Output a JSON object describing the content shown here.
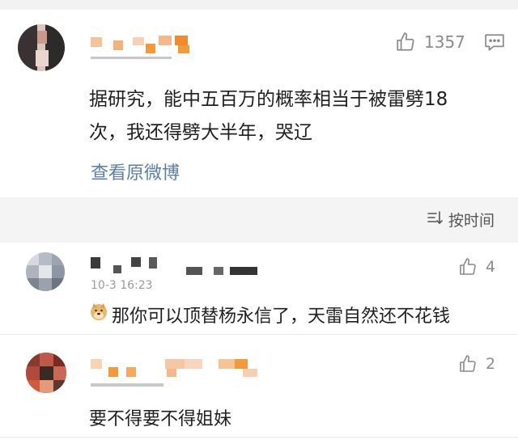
{
  "main_comment": {
    "like_count": "1357",
    "text_line1": "据研究，能中五百万的概率相当于被雷劈18",
    "text_line2": "次，我还得劈大半年，哭辽",
    "view_original_label": "查看原微博"
  },
  "sort": {
    "label": "按时间"
  },
  "replies": [
    {
      "like_count": "4",
      "timestamp": "10-3 16:23",
      "text": "那你可以顶替杨永信了，天雷自然还不花钱"
    },
    {
      "like_count": "2",
      "text": "要不得要不得姐妹"
    }
  ],
  "colors": {
    "link_blue": "#5b7fa6",
    "muted_gray": "#8a8a8a",
    "pixel_orange": "#f29a3a"
  }
}
